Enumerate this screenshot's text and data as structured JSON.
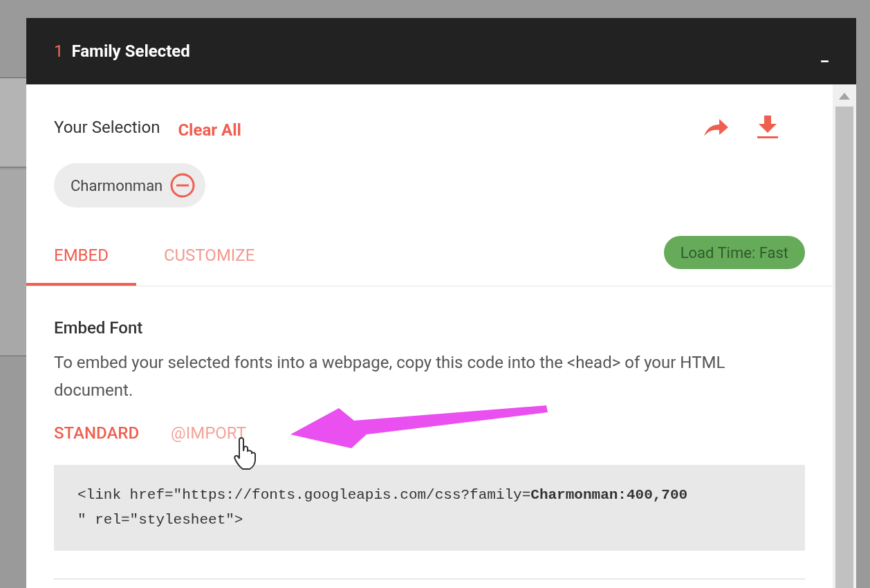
{
  "header": {
    "count": "1",
    "title": "Family Selected",
    "minimize": "_"
  },
  "selection": {
    "label": "Your Selection",
    "clear": "Clear All",
    "chips": [
      {
        "name": "Charmonman"
      }
    ]
  },
  "tabs": [
    {
      "label": "EMBED",
      "selected": true
    },
    {
      "label": "CUSTOMIZE",
      "selected": false
    }
  ],
  "load_time": {
    "label": "Load Time: Fast",
    "color": "#66ab5a"
  },
  "embed": {
    "title": "Embed Font",
    "description": "To embed your selected fonts into a webpage, copy this code into the <head> of your HTML document.",
    "methods": [
      {
        "label": "STANDARD",
        "selected": true
      },
      {
        "label": "@IMPORT",
        "selected": false
      }
    ],
    "code_lines": [
      "<link href=\"https://fonts.googleapis.com/css?family=**Charmonman:400,700**",
      "\" rel=\"stylesheet\">"
    ]
  }
}
